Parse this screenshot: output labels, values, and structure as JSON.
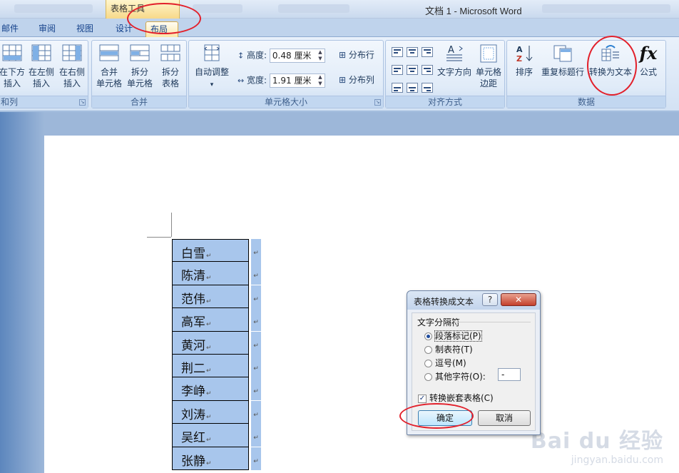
{
  "titlebar": {
    "context_tab_group": "表格工具",
    "document_title": "文档 1 - Microsoft Word"
  },
  "tabs": [
    {
      "label": "邮件",
      "active": false
    },
    {
      "label": "审阅",
      "active": false
    },
    {
      "label": "视图",
      "active": false
    },
    {
      "label": "设计",
      "active": false
    },
    {
      "label": "布局",
      "active": true
    }
  ],
  "ribbon": {
    "rows_cols": {
      "label": "和列",
      "buttons": [
        "在下方\n插入",
        "在左侧\n插入",
        "在右侧\n插入"
      ]
    },
    "merge": {
      "label": "合并",
      "buttons": [
        "合并\n单元格",
        "拆分\n单元格",
        "拆分\n表格"
      ]
    },
    "cell_size": {
      "label": "单元格大小",
      "autofit": "自动调整",
      "height_label": "高度:",
      "height_value": "0.48 厘米",
      "width_label": "宽度:",
      "width_value": "1.91 厘米",
      "distribute_rows": "分布行",
      "distribute_cols": "分布列"
    },
    "alignment": {
      "label": "对齐方式",
      "text_direction": "文字方向",
      "cell_margins": "单元格\n边距"
    },
    "data": {
      "label": "数据",
      "sort": "排序",
      "repeat_header": "重复标题行",
      "convert_to_text": "转换为文本",
      "formula": "公式"
    }
  },
  "table": {
    "rows": [
      "白雪",
      "陈清",
      "范伟",
      "高军",
      "黄河",
      "荆二",
      "李峥",
      "刘涛",
      "吴红",
      "张静"
    ]
  },
  "dialog": {
    "title": "表格转换成文本",
    "help": "?",
    "close": "✕",
    "group_label": "文字分隔符",
    "options": [
      {
        "label": "段落标记(P)",
        "selected": true
      },
      {
        "label": "制表符(T)",
        "selected": false
      },
      {
        "label": "逗号(M)",
        "selected": false
      },
      {
        "label": "其他字符(O):",
        "selected": false
      }
    ],
    "other_char_value": "-",
    "nested_label": "转换嵌套表格(C)",
    "nested_checked": true,
    "ok": "确定",
    "cancel": "取消"
  },
  "watermark": {
    "brand": "Bai du 经验",
    "url": "jingyan.baidu.com"
  },
  "colors": {
    "annotation": "#e2202b",
    "selection": "#a8c6ec"
  }
}
